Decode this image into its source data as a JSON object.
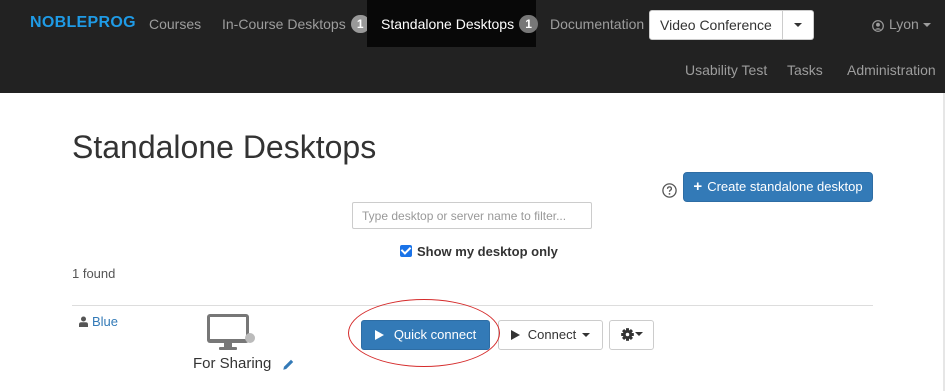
{
  "nav": {
    "brand": "NOBLEPROG",
    "courses": "Courses",
    "in_course": {
      "label": "In-Course Desktops",
      "badge": "1"
    },
    "standalone": {
      "label": "Standalone Desktops",
      "badge": "1"
    },
    "documentation": "Documentation",
    "video_conference": "Video Conference",
    "user": "Lyon",
    "usability_test": "Usability Test",
    "tasks": "Tasks",
    "administration": "Administration"
  },
  "page": {
    "title": "Standalone Desktops",
    "create_button": "Create standalone desktop",
    "filter_placeholder": "Type desktop or server name to filter...",
    "show_mine_label": "Show my desktop only",
    "show_mine_checked": true,
    "found_text": "1 found"
  },
  "desktop": {
    "owner": "Blue",
    "name": "For Sharing",
    "quick_connect": "Quick connect",
    "connect": "Connect"
  },
  "icons": [
    "user-icon",
    "help-icon",
    "plus-icon",
    "monitor-icon",
    "pencil-icon",
    "play-icon",
    "gear-icon",
    "caret-down-icon"
  ],
  "colors": {
    "navbar": "#222222",
    "active_nav": "#080808",
    "brand": "#1f9be6",
    "primary": "#337ab7",
    "highlight": "#d52b2b"
  }
}
